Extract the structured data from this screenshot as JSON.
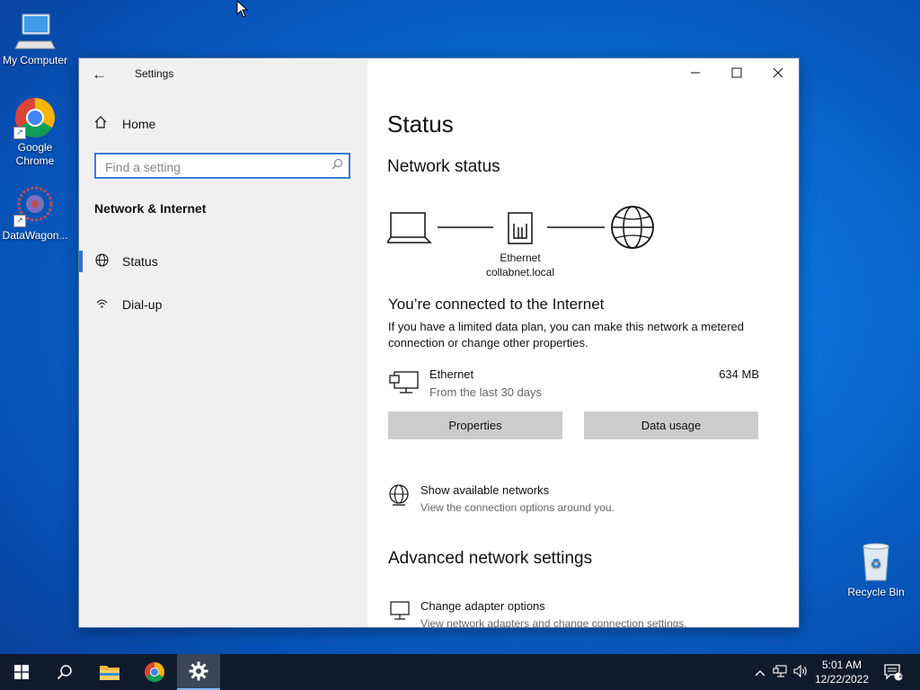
{
  "desktop": {
    "icons": [
      {
        "label": "My Computer"
      },
      {
        "label": "Google Chrome"
      },
      {
        "label": "DataWagon..."
      },
      {
        "label": "Recycle Bin"
      }
    ]
  },
  "window": {
    "app_title": "Settings",
    "sidebar": {
      "home_label": "Home",
      "search_placeholder": "Find a setting",
      "section_title": "Network & Internet",
      "items": [
        {
          "label": "Status",
          "active": true
        },
        {
          "label": "Dial-up",
          "active": false
        }
      ]
    },
    "content": {
      "title": "Status",
      "network_status_heading": "Network status",
      "adapter_label": "Ethernet",
      "adapter_domain": "collabnet.local",
      "connected_heading": "You’re connected to the Internet",
      "connected_desc": "If you have a limited data plan, you can make this network a metered connection or change other properties.",
      "connection": {
        "name": "Ethernet",
        "period": "From the last 30 days",
        "usage": "634 MB"
      },
      "buttons": {
        "properties": "Properties",
        "data_usage": "Data usage"
      },
      "show_networks": {
        "title": "Show available networks",
        "subtitle": "View the connection options around you."
      },
      "advanced_heading": "Advanced network settings",
      "change_adapter": {
        "title": "Change adapter options",
        "subtitle": "View network adapters and change connection settings."
      }
    }
  },
  "taskbar": {
    "time": "5:01 AM",
    "date": "12/22/2022",
    "notification_count": "2"
  },
  "colors": {
    "accent": "#2b6fcf",
    "taskbar": "#0f1a2a"
  }
}
